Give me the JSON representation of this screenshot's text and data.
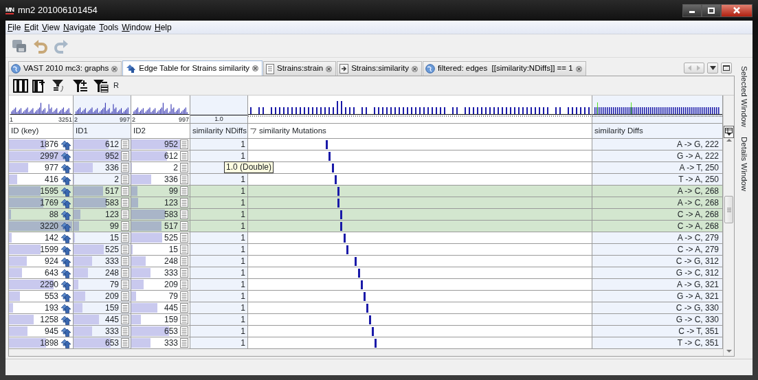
{
  "window": {
    "logo_text": "MN",
    "title": "mn2 201006101454"
  },
  "menu": [
    "File",
    "Edit",
    "View",
    "Navigate",
    "Tools",
    "Window",
    "Help"
  ],
  "tabs": [
    {
      "label": "VAST 2010 mc3: graphs",
      "selected": false
    },
    {
      "label": "Edge Table for Strains similarity",
      "selected": true
    },
    {
      "label": "Strains:strain",
      "selected": false
    },
    {
      "label": "Strains:similarity",
      "selected": false
    },
    {
      "label": "filtered: edges  [[similarity:NDiffs]] == 1",
      "selected": false
    }
  ],
  "table_toolbar": {
    "label": "R"
  },
  "columns": [
    {
      "header": "ID (key)",
      "kind": "key",
      "range_min": "1",
      "range_max": "3251",
      "highlighted": false,
      "sorted": false
    },
    {
      "header": "ID1",
      "kind": "ref",
      "range_min": "2",
      "range_max": "997",
      "highlighted": true,
      "sorted": false
    },
    {
      "header": "ID2",
      "kind": "ref",
      "range_min": "2",
      "range_max": "997",
      "highlighted": false,
      "sorted": false
    },
    {
      "header": "similarity NDiffs",
      "kind": "number",
      "range_center": "1.0",
      "highlighted": true,
      "sorted": false
    },
    {
      "header": "similarity Mutations",
      "kind": "mutation",
      "highlighted": false,
      "sorted": true
    },
    {
      "header": "similarity Diffs",
      "kind": "text",
      "highlighted": true,
      "sorted": false
    }
  ],
  "rows": [
    {
      "id": {
        "text": "1876",
        "level": 0.58
      },
      "id1": {
        "text": "612",
        "level": 0.61
      },
      "id2": {
        "text": "952",
        "level": 0.95
      },
      "ndiffs": "1",
      "mutation": {
        "level": 0.226
      },
      "diffs": "A -> G, 222",
      "selected": false
    },
    {
      "id": {
        "text": "2997",
        "level": 0.92
      },
      "id1": {
        "text": "952",
        "level": 0.95
      },
      "id2": {
        "text": "612",
        "level": 0.61
      },
      "ndiffs": "1",
      "mutation": {
        "level": 0.234
      },
      "diffs": "G -> A, 222",
      "selected": false
    },
    {
      "id": {
        "text": "977",
        "level": 0.3
      },
      "id1": {
        "text": "336",
        "level": 0.34
      },
      "id2": {
        "text": "2",
        "level": 0
      },
      "mutation": {
        "level": 0.244
      },
      "diffs": "A -> T, 250",
      "selected": false
    },
    {
      "id": {
        "text": "416",
        "level": 0.13
      },
      "id1": {
        "text": "2",
        "level": 0
      },
      "id2": {
        "text": "336",
        "level": 0.34
      },
      "ndiffs": "1",
      "mutation": {
        "level": 0.252
      },
      "diffs": "T -> A, 250",
      "selected": false
    },
    {
      "id": {
        "text": "1595",
        "level": 0.49
      },
      "id1": {
        "text": "517",
        "level": 0.52
      },
      "id2": {
        "text": "99",
        "level": 0.1
      },
      "ndiffs": "1",
      "mutation": {
        "level": 0.26
      },
      "diffs": "A -> C, 268",
      "selected": true
    },
    {
      "id": {
        "text": "1769",
        "level": 0.54
      },
      "id1": {
        "text": "583",
        "level": 0.58
      },
      "id2": {
        "text": "123",
        "level": 0.12
      },
      "ndiffs": "1",
      "mutation": {
        "level": 0.26
      },
      "diffs": "A -> C, 268",
      "selected": true
    },
    {
      "id": {
        "text": "88",
        "level": 0.03
      },
      "id1": {
        "text": "123",
        "level": 0.12
      },
      "id2": {
        "text": "583",
        "level": 0.58
      },
      "ndiffs": "1",
      "mutation": {
        "level": 0.268
      },
      "diffs": "C -> A, 268",
      "selected": true
    },
    {
      "id": {
        "text": "3220",
        "level": 0.99
      },
      "id1": {
        "text": "99",
        "level": 0.1
      },
      "id2": {
        "text": "517",
        "level": 0.52
      },
      "ndiffs": "1",
      "mutation": {
        "level": 0.268
      },
      "diffs": "C -> A, 268",
      "selected": true
    },
    {
      "id": {
        "text": "142",
        "level": 0.04
      },
      "id1": {
        "text": "15",
        "level": 0.02
      },
      "id2": {
        "text": "525",
        "level": 0.53
      },
      "ndiffs": "1",
      "mutation": {
        "level": 0.278
      },
      "diffs": "A -> C, 279",
      "selected": false
    },
    {
      "id": {
        "text": "1599",
        "level": 0.49
      },
      "id1": {
        "text": "525",
        "level": 0.53
      },
      "id2": {
        "text": "15",
        "level": 0.02
      },
      "ndiffs": "1",
      "mutation": {
        "level": 0.286
      },
      "diffs": "C -> A, 279",
      "selected": false
    },
    {
      "id": {
        "text": "924",
        "level": 0.28
      },
      "id1": {
        "text": "333",
        "level": 0.33
      },
      "id2": {
        "text": "248",
        "level": 0.25
      },
      "ndiffs": "1",
      "mutation": {
        "level": 0.31
      },
      "diffs": "C -> G, 312",
      "selected": false
    },
    {
      "id": {
        "text": "643",
        "level": 0.2
      },
      "id1": {
        "text": "248",
        "level": 0.25
      },
      "id2": {
        "text": "333",
        "level": 0.33
      },
      "ndiffs": "1",
      "mutation": {
        "level": 0.32
      },
      "diffs": "G -> C, 312",
      "selected": false
    },
    {
      "id": {
        "text": "2290",
        "level": 0.7
      },
      "id1": {
        "text": "79",
        "level": 0.08
      },
      "id2": {
        "text": "209",
        "level": 0.21
      },
      "ndiffs": "1",
      "mutation": {
        "level": 0.328
      },
      "diffs": "A -> G, 321",
      "selected": false
    },
    {
      "id": {
        "text": "553",
        "level": 0.17
      },
      "id1": {
        "text": "209",
        "level": 0.21
      },
      "id2": {
        "text": "79",
        "level": 0.08
      },
      "ndiffs": "1",
      "mutation": {
        "level": 0.336
      },
      "diffs": "G -> A, 321",
      "selected": false
    },
    {
      "id": {
        "text": "193",
        "level": 0.06
      },
      "id1": {
        "text": "159",
        "level": 0.16
      },
      "id2": {
        "text": "445",
        "level": 0.45
      },
      "ndiffs": "1",
      "mutation": {
        "level": 0.344
      },
      "diffs": "C -> G, 330",
      "selected": false
    },
    {
      "id": {
        "text": "1258",
        "level": 0.39
      },
      "id1": {
        "text": "445",
        "level": 0.45
      },
      "id2": {
        "text": "159",
        "level": 0.16
      },
      "ndiffs": "1",
      "mutation": {
        "level": 0.352
      },
      "diffs": "G -> C, 330",
      "selected": false
    },
    {
      "id": {
        "text": "945",
        "level": 0.29
      },
      "id1": {
        "text": "333",
        "level": 0.33
      },
      "id2": {
        "text": "653",
        "level": 0.65
      },
      "ndiffs": "1",
      "mutation": {
        "level": 0.36
      },
      "diffs": "C -> T, 351",
      "selected": false
    },
    {
      "id": {
        "text": "1898",
        "level": 0.58
      },
      "id1": {
        "text": "653",
        "level": 0.65
      },
      "id2": {
        "text": "333",
        "level": 0.33
      },
      "ndiffs": "1",
      "mutation": {
        "level": 0.368
      },
      "diffs": "T -> C, 351",
      "selected": false
    }
  ],
  "tooltip": {
    "text": "1.0 (Double)"
  },
  "side_panel": [
    "Selected Window",
    "Details Window"
  ]
}
